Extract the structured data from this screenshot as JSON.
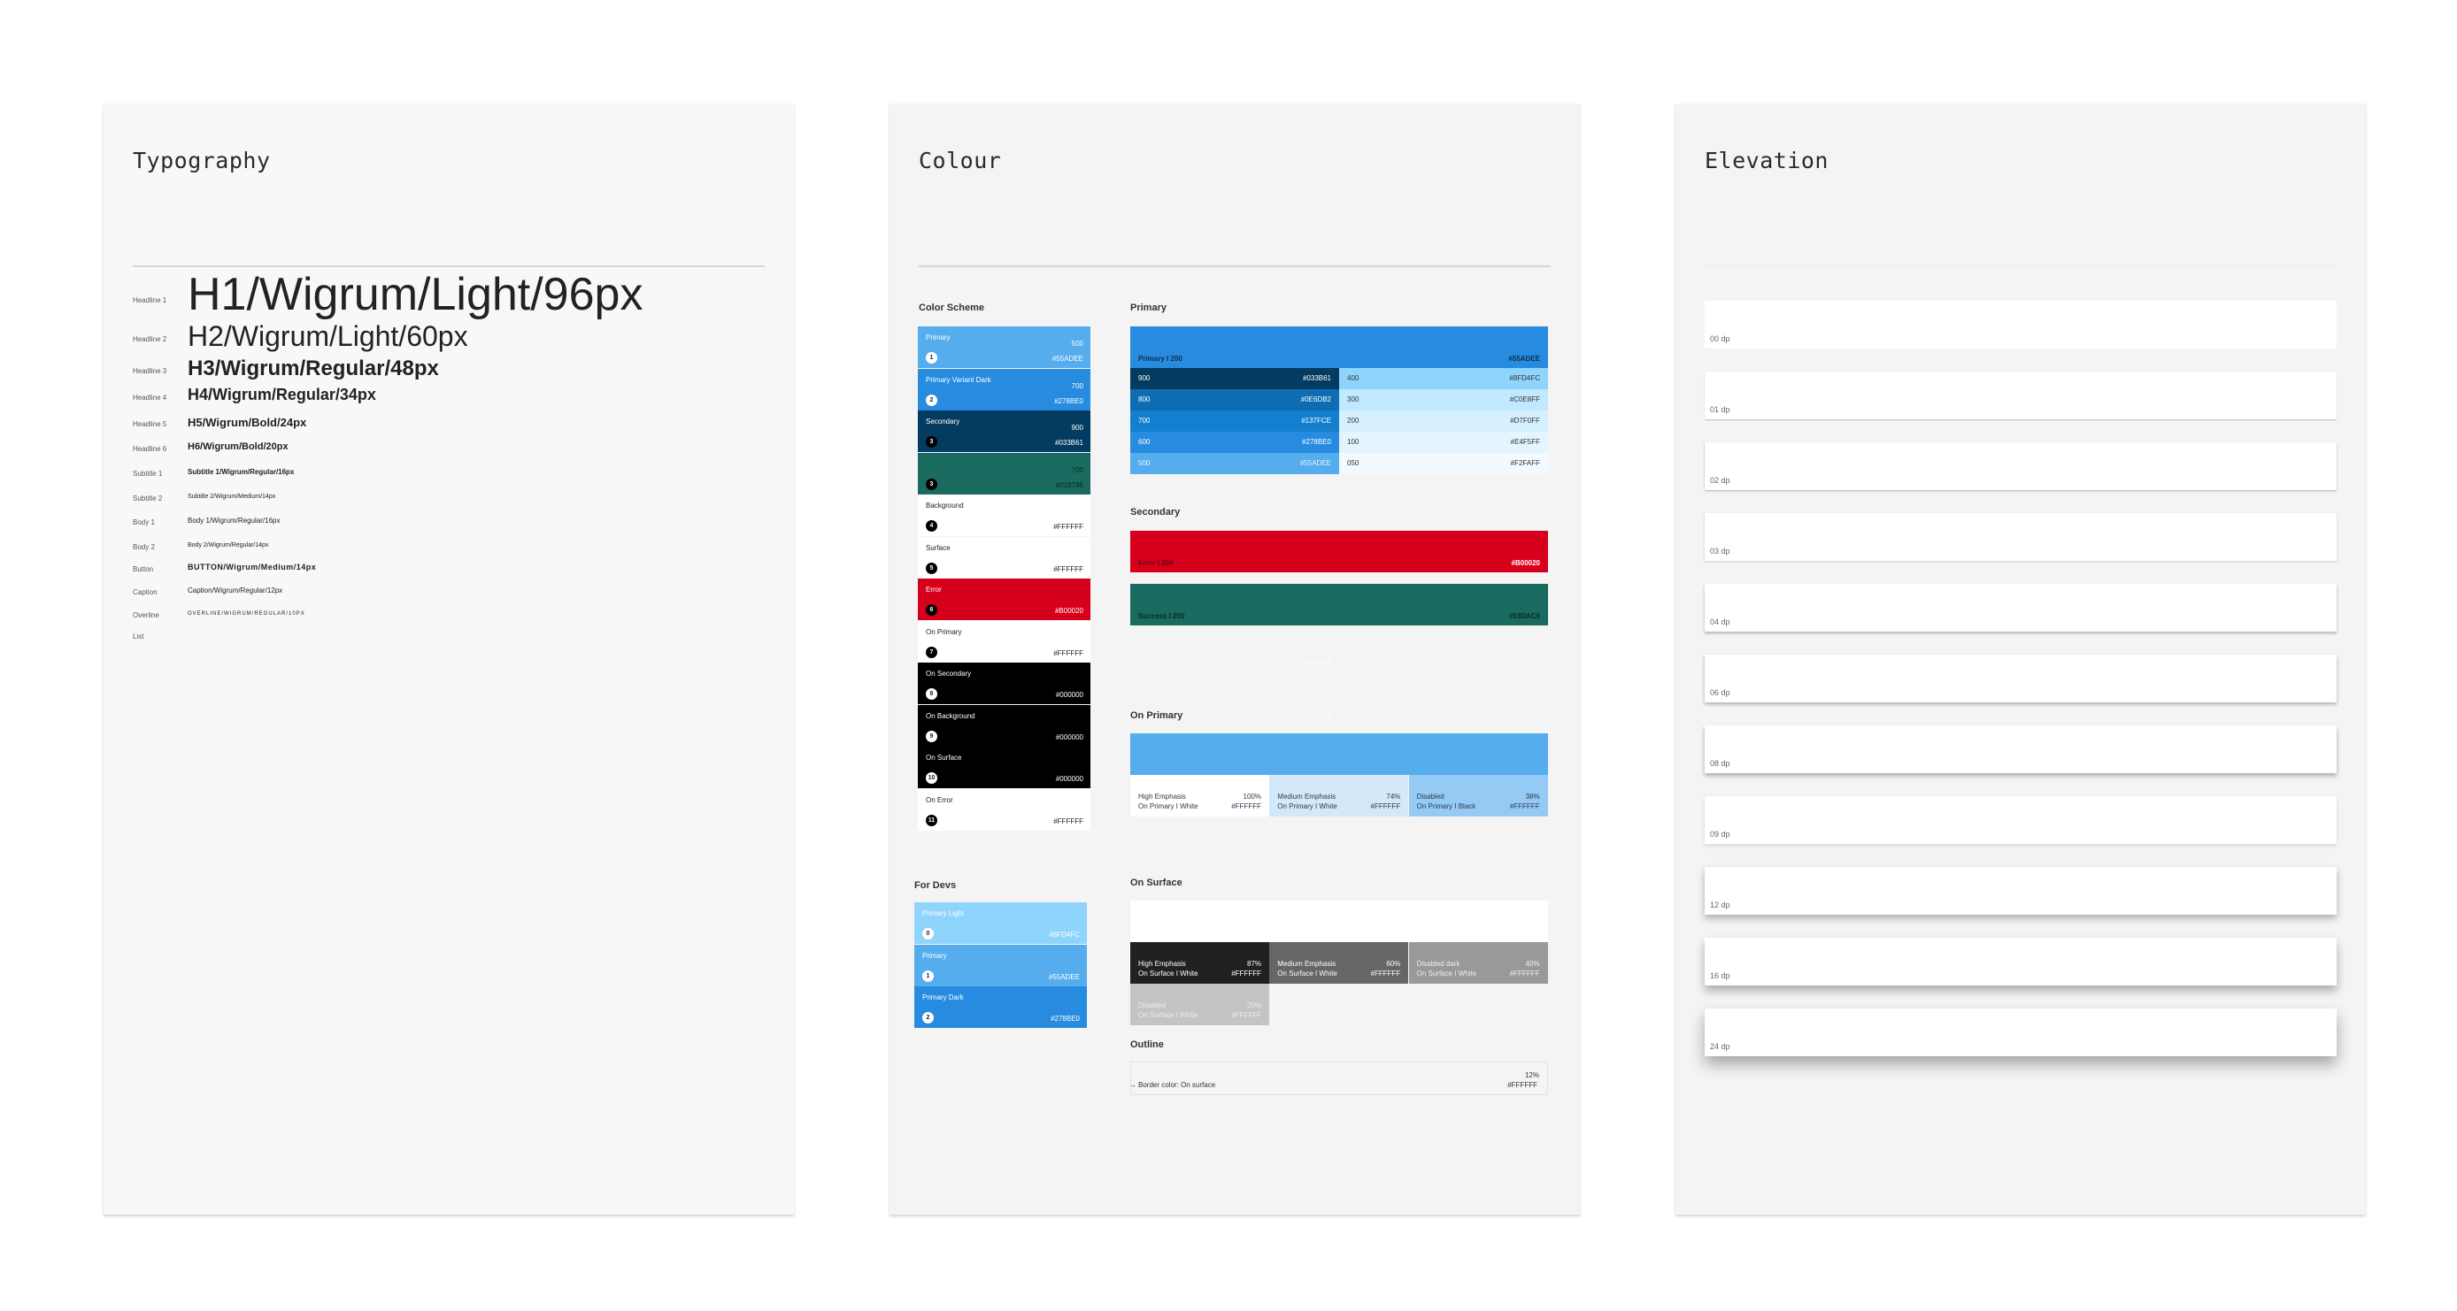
{
  "boards": {
    "typography": {
      "title": "Typography",
      "rows": [
        {
          "label": "Headline 1",
          "sample": "H1/Wigrum/Light/96px"
        },
        {
          "label": "Headline 2",
          "sample": "H2/Wigrum/Light/60px"
        },
        {
          "label": "Headline 3",
          "sample": "H3/Wigrum/Regular/48px"
        },
        {
          "label": "Headline 4",
          "sample": "H4/Wigrum/Regular/34px"
        },
        {
          "label": "Headline 5",
          "sample": "H5/Wigrum/Bold/24px"
        },
        {
          "label": "Headline 6",
          "sample": "H6/Wigrum/Bold/20px"
        },
        {
          "label": "Subtitle 1",
          "sample": "Subtitle 1/Wigrum/Regular/16px"
        },
        {
          "label": "Subtitle 2",
          "sample": "Subtitle 2/Wigrum/Medium/14px"
        },
        {
          "label": "Body 1",
          "sample": "Body 1/Wigrum/Regular/16px"
        },
        {
          "label": "Body 2",
          "sample": "Body 2/Wigrum/Regular/14px"
        },
        {
          "label": "Button",
          "sample": "BUTTON/Wigrum/Medium/14px"
        },
        {
          "label": "Caption",
          "sample": "Caption/Wigrum/Regular/12px"
        },
        {
          "label": "Overline",
          "sample": "OVERLINE/WIGRUM/REGULAR/10PX"
        },
        {
          "label": "List",
          "sample": ""
        }
      ]
    },
    "colour": {
      "title": "Colour",
      "color_scheme": {
        "heading": "Color Scheme",
        "swatches": [
          {
            "name": "Primary",
            "badge": "1",
            "weight": "500",
            "hex": "#55ADEE",
            "bg": "#55ADEE",
            "fg": "#ffffff"
          },
          {
            "name": "Primary Variant Dark",
            "badge": "2",
            "weight": "700",
            "hex": "#278BE0",
            "bg": "#278BE0",
            "fg": "#ffffff"
          },
          {
            "name": "Secondary",
            "badge": "3",
            "weight": "900",
            "hex": "#033B61",
            "bg": "#033B61",
            "fg": "#ffffff"
          },
          {
            "name": "",
            "badge": "3",
            "weight": "700",
            "hex": "#018786",
            "bg": "#196A5F",
            "fg": "#0c2a26"
          },
          {
            "name": "Background",
            "badge": "4",
            "weight": "",
            "hex": "#FFFFFF",
            "bg": "#FFFFFF",
            "fg": "#222222"
          },
          {
            "name": "Surface",
            "badge": "5",
            "weight": "",
            "hex": "#FFFFFF",
            "bg": "#FFFFFF",
            "fg": "#222222"
          },
          {
            "name": "Error",
            "badge": "6",
            "weight": "",
            "hex": "#B00020",
            "bg": "#D6001C",
            "fg": "#ffffff"
          },
          {
            "name": "On Primary",
            "badge": "7",
            "weight": "",
            "hex": "#FFFFFF",
            "bg": "#FFFFFF",
            "fg": "#222222"
          },
          {
            "name": "On Secondary",
            "badge": "8",
            "weight": "",
            "hex": "#000000",
            "bg": "#000000",
            "fg": "#ffffff"
          },
          {
            "name": "On Background",
            "badge": "9",
            "weight": "",
            "hex": "#000000",
            "bg": "#000000",
            "fg": "#ffffff"
          },
          {
            "name": "On Surface",
            "badge": "10",
            "weight": "",
            "hex": "#000000",
            "bg": "#000000",
            "fg": "#ffffff"
          },
          {
            "name": "On Error",
            "badge": "11",
            "weight": "",
            "hex": "#FFFFFF",
            "bg": "#FFFFFF",
            "fg": "#222222"
          }
        ]
      },
      "for_devs": {
        "heading": "For Devs",
        "swatches": [
          {
            "name": "Primary Light",
            "badge": "0",
            "hex": "#8FD4FC",
            "bg": "#8FD4FC"
          },
          {
            "name": "Primary",
            "badge": "1",
            "hex": "#55ADEE",
            "bg": "#55ADEE"
          },
          {
            "name": "Primary Dark",
            "badge": "2",
            "hex": "#278BE0",
            "bg": "#278BE0"
          }
        ]
      },
      "primary": {
        "heading": "Primary",
        "header_label": "Primary I 200",
        "header_hex": "#55ADEE",
        "left": [
          {
            "weight": "900",
            "hex": "#033B61",
            "bg": "#033B61"
          },
          {
            "weight": "800",
            "hex": "#0E6DB2",
            "bg": "#0E6DB2"
          },
          {
            "weight": "700",
            "hex": "#137FCE",
            "bg": "#137FCE"
          },
          {
            "weight": "600",
            "hex": "#278BE0",
            "bg": "#278BE0"
          },
          {
            "weight": "500",
            "hex": "#55ADEE",
            "bg": "#55ADEE"
          }
        ],
        "right": [
          {
            "weight": "400",
            "hex": "#8FD4FC",
            "bg": "#8FD4FC"
          },
          {
            "weight": "300",
            "hex": "#C0E8FF",
            "bg": "#C0E8FF"
          },
          {
            "weight": "200",
            "hex": "#D7F0FF",
            "bg": "#D7F0FF"
          },
          {
            "weight": "100",
            "hex": "#E4F5FF",
            "bg": "#E4F5FF"
          },
          {
            "weight": "050",
            "hex": "#F2FAFF",
            "bg": "#F2FAFF"
          }
        ]
      },
      "secondary": {
        "heading": "Secondary",
        "bars": [
          {
            "label": "Error I 200",
            "hex": "#B00020",
            "bg": "#D6001C"
          },
          {
            "label": "Success I 200",
            "hex": "#03DAC5",
            "bg": "#196A5F"
          }
        ],
        "ghost": {
          "weight": "500",
          "hex": "#01A299"
        }
      },
      "on_primary": {
        "heading": "On Primary",
        "ghost_hex": "#01A299",
        "cells": [
          {
            "title": "High Emphasis",
            "sub": "On Primary I White",
            "pct": "100%",
            "hex": "#FFFFFF",
            "bg": "#FFFFFF"
          },
          {
            "title": "Medium Emphasis",
            "sub": "On Primary I White",
            "pct": "74%",
            "hex": "#FFFFFF",
            "bg": "#D3E9FA"
          },
          {
            "title": "Disabled",
            "sub": "On Primary I Black",
            "pct": "38%",
            "hex": "#FFFFFF",
            "bg": "#95CAF4"
          }
        ]
      },
      "on_surface": {
        "heading": "On Surface",
        "cells": [
          {
            "title": "High Emphasis",
            "sub": "On Surface I White",
            "pct": "87%",
            "hex": "#FFFFFF",
            "bg": "#212121"
          },
          {
            "title": "Medium Emphasis",
            "sub": "On Surface I White",
            "pct": "60%",
            "hex": "#FFFFFF",
            "bg": "#666666"
          },
          {
            "title": "Disabled dark",
            "sub": "On Surface I White",
            "pct": "40%",
            "hex": "#FFFFFF",
            "bg": "#999999"
          },
          {
            "title": "Disabled",
            "sub": "On Surface I White",
            "pct": "20%",
            "hex": "#FFFFFF",
            "bg": "#C4C4C4"
          }
        ]
      },
      "outline": {
        "heading": "Outline",
        "label": "Border color: On surface",
        "pct": "12%",
        "hex": "#FFFFFF"
      }
    },
    "elevation": {
      "title": "Elevation",
      "levels": [
        {
          "label": "00 dp",
          "dp": 0
        },
        {
          "label": "01 dp",
          "dp": 1
        },
        {
          "label": "02 dp",
          "dp": 2
        },
        {
          "label": "03 dp",
          "dp": 3
        },
        {
          "label": "04 dp",
          "dp": 4
        },
        {
          "label": "06 dp",
          "dp": 6
        },
        {
          "label": "08 dp",
          "dp": 8
        },
        {
          "label": "09 dp",
          "dp": 9
        },
        {
          "label": "12 dp",
          "dp": 12
        },
        {
          "label": "16 dp",
          "dp": 16
        },
        {
          "label": "24 dp",
          "dp": 24
        }
      ]
    }
  }
}
